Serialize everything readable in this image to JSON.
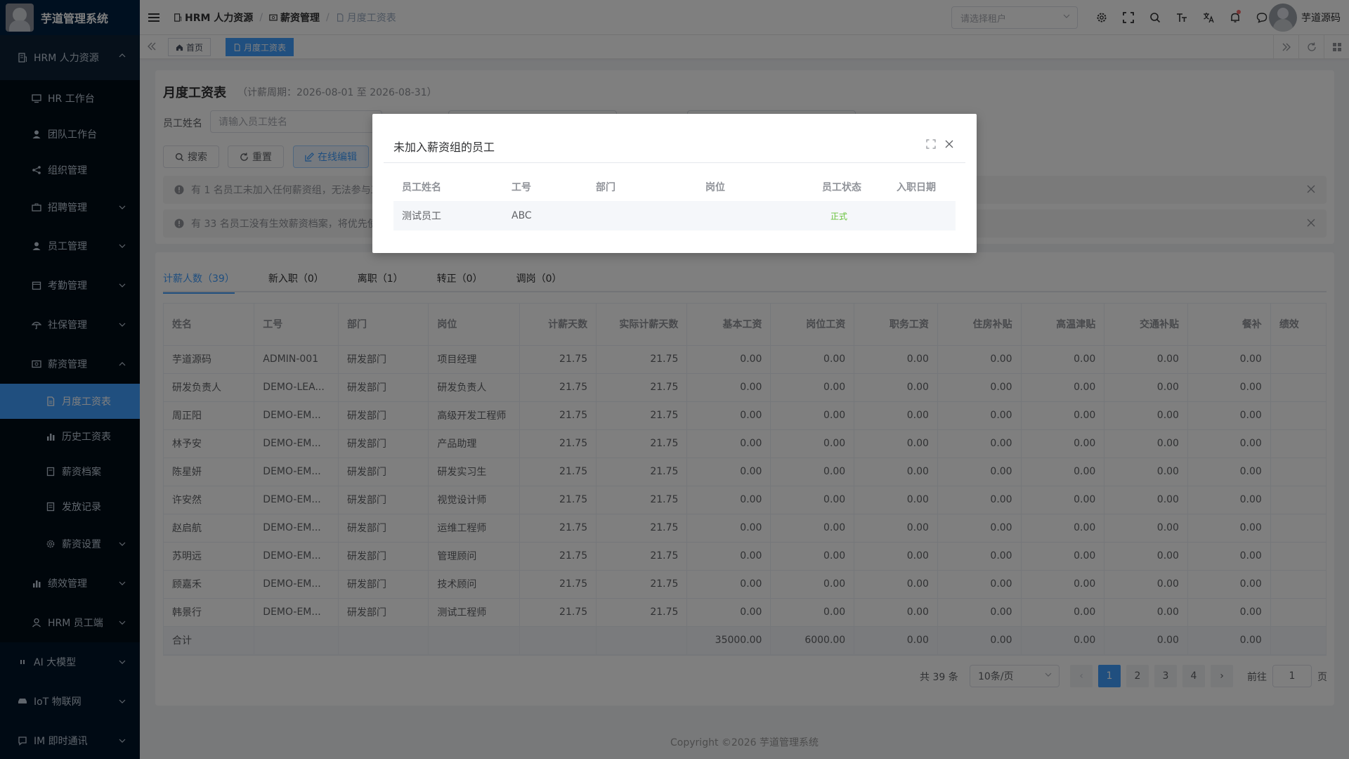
{
  "app": {
    "title": "芋道管理系统"
  },
  "sidebar": {
    "items": [
      {
        "label": "HRM 人力资源"
      },
      {
        "label": "HR 工作台"
      },
      {
        "label": "团队工作台"
      },
      {
        "label": "组织管理"
      },
      {
        "label": "招聘管理"
      },
      {
        "label": "员工管理"
      },
      {
        "label": "考勤管理"
      },
      {
        "label": "社保管理"
      },
      {
        "label": "薪资管理"
      },
      {
        "label": "月度工资表"
      },
      {
        "label": "历史工资表"
      },
      {
        "label": "薪资档案"
      },
      {
        "label": "发放记录"
      },
      {
        "label": "薪资设置"
      },
      {
        "label": "绩效管理"
      },
      {
        "label": "HRM 员工端"
      },
      {
        "label": "AI 大模型"
      },
      {
        "label": "IoT 物联网"
      },
      {
        "label": "IM 即时通讯"
      }
    ]
  },
  "header": {
    "breadcrumb": [
      "HRM 人力资源",
      "薪资管理",
      "月度工资表"
    ],
    "separator": "/",
    "tenant_placeholder": "请选择租户",
    "user_name": "芋道源码"
  },
  "tags": {
    "home": "首页",
    "current": "月度工资表"
  },
  "page": {
    "title": "月度工资表",
    "period": "（计薪周期：2026-08-01 至 2026-08-31）",
    "filter_label": "员工姓名",
    "filter_placeholder": "请输入员工姓名",
    "search_btn": "搜索",
    "reset_btn": "重置",
    "edit_btn": "在线编辑",
    "alert1": "有 1 名员工未加入任何薪资组，无法参与工",
    "alert2": "有 33 名员工没有生效薪资档案，将优先使"
  },
  "tabs": [
    "计薪人数（39）",
    "新入职（0）",
    "离职（1）",
    "转正（0）",
    "调岗（0）"
  ],
  "table": {
    "columns": [
      "姓名",
      "工号",
      "部门",
      "岗位",
      "计薪天数",
      "实际计薪天数",
      "基本工资",
      "岗位工资",
      "职务工资",
      "住房补贴",
      "高温津贴",
      "交通补贴",
      "餐补",
      "绩效"
    ],
    "rows": [
      [
        "芋道源码",
        "ADMIN-001",
        "研发部门",
        "项目经理",
        "21.75",
        "21.75",
        "0.00",
        "0.00",
        "0.00",
        "0.00",
        "0.00",
        "0.00",
        "0.00",
        ""
      ],
      [
        "研发负责人",
        "DEMO-LEA...",
        "研发部门",
        "研发负责人",
        "21.75",
        "21.75",
        "0.00",
        "0.00",
        "0.00",
        "0.00",
        "0.00",
        "0.00",
        "0.00",
        ""
      ],
      [
        "周正阳",
        "DEMO-EM...",
        "研发部门",
        "高级开发工程师",
        "21.75",
        "21.75",
        "0.00",
        "0.00",
        "0.00",
        "0.00",
        "0.00",
        "0.00",
        "0.00",
        ""
      ],
      [
        "林予安",
        "DEMO-EM...",
        "研发部门",
        "产品助理",
        "21.75",
        "21.75",
        "0.00",
        "0.00",
        "0.00",
        "0.00",
        "0.00",
        "0.00",
        "0.00",
        ""
      ],
      [
        "陈星妍",
        "DEMO-EM...",
        "研发部门",
        "研发实习生",
        "21.75",
        "21.75",
        "0.00",
        "0.00",
        "0.00",
        "0.00",
        "0.00",
        "0.00",
        "0.00",
        ""
      ],
      [
        "许安然",
        "DEMO-EM...",
        "研发部门",
        "视觉设计师",
        "21.75",
        "21.75",
        "0.00",
        "0.00",
        "0.00",
        "0.00",
        "0.00",
        "0.00",
        "0.00",
        ""
      ],
      [
        "赵启航",
        "DEMO-EM...",
        "研发部门",
        "运维工程师",
        "21.75",
        "21.75",
        "0.00",
        "0.00",
        "0.00",
        "0.00",
        "0.00",
        "0.00",
        "0.00",
        ""
      ],
      [
        "苏明远",
        "DEMO-EM...",
        "研发部门",
        "管理顾问",
        "21.75",
        "21.75",
        "0.00",
        "0.00",
        "0.00",
        "0.00",
        "0.00",
        "0.00",
        "0.00",
        ""
      ],
      [
        "顾嘉禾",
        "DEMO-EM...",
        "研发部门",
        "技术顾问",
        "21.75",
        "21.75",
        "0.00",
        "0.00",
        "0.00",
        "0.00",
        "0.00",
        "0.00",
        "0.00",
        ""
      ],
      [
        "韩景行",
        "DEMO-EM...",
        "研发部门",
        "测试工程师",
        "21.75",
        "21.75",
        "0.00",
        "0.00",
        "0.00",
        "0.00",
        "0.00",
        "0.00",
        "0.00",
        ""
      ],
      [
        "合计",
        "",
        "",
        "",
        "",
        "",
        "35000.00",
        "6000.00",
        "0.00",
        "0.00",
        "0.00",
        "0.00",
        "0.00",
        ""
      ]
    ]
  },
  "pagination": {
    "total": "共 39 条",
    "page_size": "10条/页",
    "pages": [
      "1",
      "2",
      "3",
      "4"
    ],
    "current_page": "1",
    "prev": "‹",
    "next": "›",
    "goto_label": "前往",
    "goto_value": "1",
    "goto_unit": "页"
  },
  "footer": "Copyright ©2026 芋道管理系统",
  "dialog": {
    "title": "未加入薪资组的员工",
    "columns": [
      "员工姓名",
      "工号",
      "部门",
      "岗位",
      "员工状态",
      "入职日期"
    ],
    "rows": [
      [
        "测试员工",
        "ABC",
        "",
        "",
        "正式",
        ""
      ]
    ]
  },
  "colors": {
    "primary": "#409eff",
    "sidebar_bg": "#001529",
    "success": "#67c23a"
  }
}
